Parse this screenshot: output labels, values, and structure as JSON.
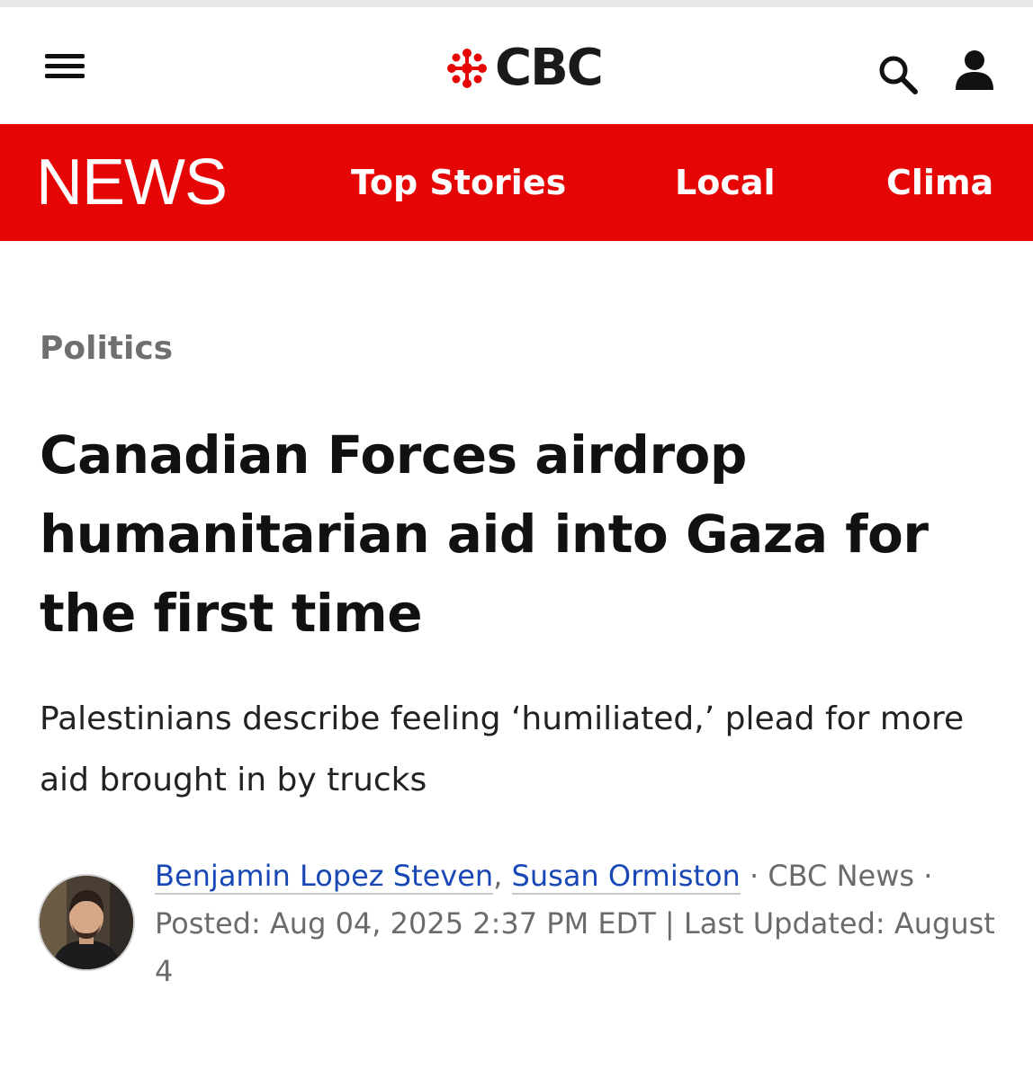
{
  "header": {
    "logo_text": "CBC",
    "brand_color": "#e60505",
    "icons": [
      "hamburger-menu-icon",
      "cbc-gem-icon",
      "search-icon",
      "user-icon"
    ]
  },
  "nav": {
    "section_label": "NEWS",
    "items": [
      {
        "label": "Top Stories"
      },
      {
        "label": "Local"
      },
      {
        "label": "Clima"
      }
    ]
  },
  "article": {
    "category": "Politics",
    "headline": "Canadian Forces airdrop humanitarian aid into Gaza for the first time",
    "deck": "Palestinians describe feeling ‘humiliated,’ plead for more aid brought in by trucks",
    "authors": [
      "Benjamin Lopez Steven",
      "Susan Ormiston"
    ],
    "author_separator": ",",
    "source": "· CBC News ·",
    "posted": "Posted: Aug 04, 2025 2:37 PM EDT | Last Updated: August 4"
  }
}
